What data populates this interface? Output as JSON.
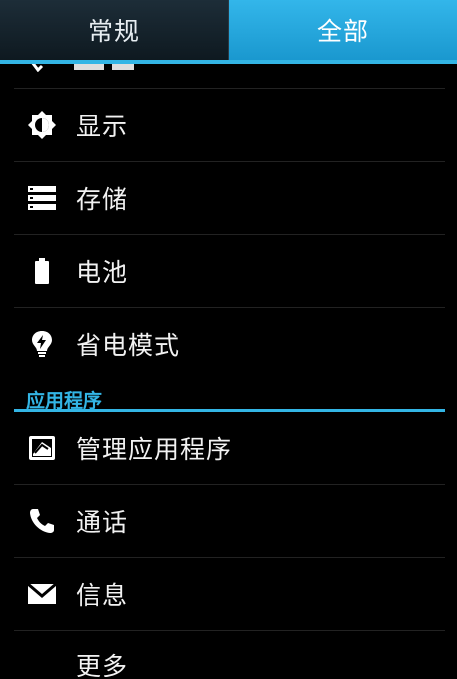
{
  "tabs": [
    {
      "label": "常规",
      "selected": false
    },
    {
      "label": "全部",
      "selected": true
    }
  ],
  "items_top": [
    {
      "label": "显示",
      "icon": "brightness-icon"
    },
    {
      "label": "存储",
      "icon": "storage-icon"
    },
    {
      "label": "电池",
      "icon": "battery-icon"
    },
    {
      "label": "省电模式",
      "icon": "power-saving-icon"
    }
  ],
  "section": {
    "title": "应用程序"
  },
  "items_apps": [
    {
      "label": "管理应用程序",
      "icon": "manage-apps-icon"
    },
    {
      "label": "通话",
      "icon": "phone-icon"
    },
    {
      "label": "信息",
      "icon": "message-icon"
    },
    {
      "label": "更多",
      "icon": ""
    }
  ],
  "colors": {
    "accent": "#33b5e5",
    "background": "#000000"
  }
}
